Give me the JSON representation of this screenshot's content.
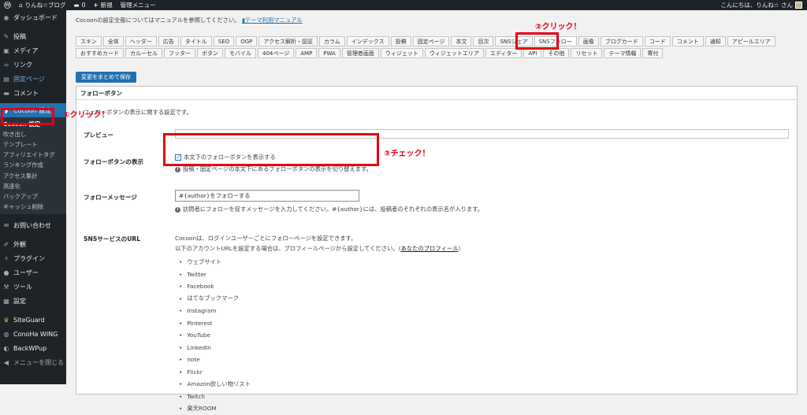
{
  "adminbar": {
    "site_name": "りんね☆ブログ",
    "comment_count": "0",
    "new_label": "新規",
    "admin_menu": "管理メニュー",
    "greeting": "こんにちは、りんね☆ さん"
  },
  "sidebar": {
    "items": [
      {
        "label": "ダッシュボード",
        "icon": "dashboard-icon"
      },
      {
        "label": "投稿",
        "icon": "pin-icon"
      },
      {
        "label": "メディア",
        "icon": "media-icon"
      },
      {
        "label": "リンク",
        "icon": "link-icon"
      },
      {
        "label": "固定ページ",
        "icon": "page-icon"
      },
      {
        "label": "コメント",
        "icon": "comment-icon"
      }
    ],
    "cocoon_label": "Cocoon 設定",
    "submenu": [
      "Cocoon 設定",
      "吹き出し",
      "テンプレート",
      "アフィリエイトタグ",
      "ランキング作成",
      "アクセス集計",
      "高速化",
      "バックアップ",
      "キャッシュ削除"
    ],
    "items2": [
      {
        "label": "お問い合わせ",
        "icon": "mail-icon"
      },
      {
        "label": "外観",
        "icon": "brush-icon"
      },
      {
        "label": "プラグイン",
        "icon": "plugin-icon"
      },
      {
        "label": "ユーザー",
        "icon": "user-icon"
      },
      {
        "label": "ツール",
        "icon": "wrench-icon"
      },
      {
        "label": "設定",
        "icon": "settings-icon"
      },
      {
        "label": "SiteGuard",
        "icon": "siteguard-icon"
      },
      {
        "label": "ConoHa WING",
        "icon": "conoha-icon"
      },
      {
        "label": "BackWPup",
        "icon": "backwpup-icon"
      },
      {
        "label": "メニューを閉じる",
        "icon": "collapse-icon"
      }
    ]
  },
  "main": {
    "intro_text": "Cocoonの設定全般についてはマニュアルを参照してください。",
    "manual_link": "テーマ利用マニュアル",
    "tabs_row1": [
      "スキン",
      "全体",
      "ヘッダー",
      "広告",
      "タイトル",
      "SEO",
      "OGP",
      "アクセス解析・認証",
      "カラム",
      "インデックス",
      "投稿",
      "固定ページ",
      "本文",
      "目次",
      "SNSシェア",
      "SNSフォロー",
      "画像",
      "ブログカード",
      "コード",
      "コメント",
      "通知",
      "アピールエリア",
      "おすすめカード"
    ],
    "tabs_row2": [
      "カルーセル",
      "フッター",
      "ボタン",
      "モバイル",
      "404ページ",
      "AMP",
      "PWA",
      "管理者画面",
      "ウィジェット",
      "ウィジェットエリア",
      "エディター",
      "API",
      "その他",
      "リセット",
      "テーマ情報",
      "寄付"
    ],
    "active_tab": "SNSフォロー",
    "save_button": "変更をまとめて保存",
    "panel_title": "フォローボタン",
    "panel_desc": "フォローボタンの表示に関する設定です。",
    "preview_label": "プレビュー",
    "show_label": "フォローボタンの表示",
    "show_checkbox_label": "本文下のフォローボタンを表示する",
    "show_checked": true,
    "show_help": "投稿・固定ページの本文下にあるフォローボタンの表示を切り替えます。",
    "message_label": "フォローメッセージ",
    "message_value": "#{author}をフォローする",
    "message_help": "訪問者にフォローを促すメッセージを入力してください。#{author}には、投稿者のそれぞれの表示名が入ります。",
    "sns_label": "SNSサービスのURL",
    "sns_desc1": "Cocoonは、ログインユーザーごとにフォローページを設定できます。",
    "sns_desc2": "以下のアカウントURLを設定する場合は、プロフィールページから設定してください。(",
    "sns_profile_link": "あなたのプロフィール",
    "sns_desc2_end": ")",
    "sns_list": [
      "ウェブサイト",
      "Twitter",
      "Facebook",
      "はてなブックマーク",
      "Instagram",
      "Pinterest",
      "YouTube",
      "LinkedIn",
      "note",
      "Flickr",
      "Amazon欲しい物リスト",
      "Twitch",
      "楽天ROOM"
    ]
  },
  "annotations": {
    "step1": "①クリック！",
    "step2": "②クリック！",
    "step3": "③チェック！",
    "color": "#e60012"
  }
}
